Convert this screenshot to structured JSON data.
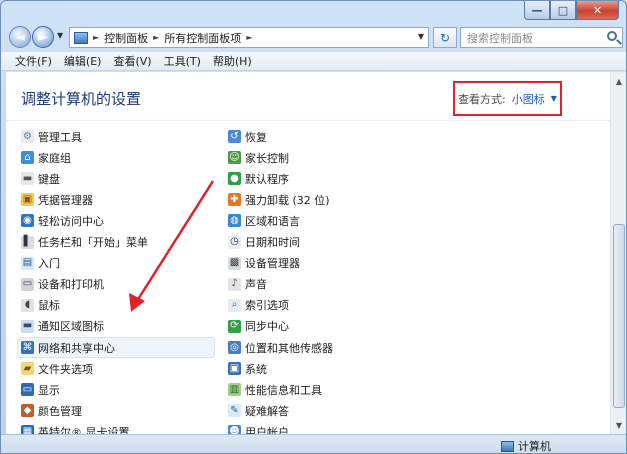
{
  "window": {
    "caption_buttons": {
      "minimize": "—",
      "maximize": "□",
      "close": "✕"
    }
  },
  "navigation": {
    "back": "◄",
    "forward": "►",
    "breadcrumbs": [
      "控制面板",
      "所有控制面板项"
    ],
    "refresh": "↻",
    "search_placeholder": "搜索控制面板"
  },
  "menu": [
    "文件(F)",
    "编辑(E)",
    "查看(V)",
    "工具(T)",
    "帮助(H)"
  ],
  "header": {
    "title": "调整计算机的设置",
    "view_by_label": "查看方式:",
    "view_by_value": "小图标"
  },
  "items_left": [
    {
      "label": "管理工具",
      "icon": "tools-icon"
    },
    {
      "label": "家庭组",
      "icon": "homegroup-icon"
    },
    {
      "label": "键盘",
      "icon": "keyboard-icon"
    },
    {
      "label": "凭据管理器",
      "icon": "credential-icon"
    },
    {
      "label": "轻松访问中心",
      "icon": "ease-of-access-icon"
    },
    {
      "label": "任务栏和「开始」菜单",
      "icon": "taskbar-icon"
    },
    {
      "label": "入门",
      "icon": "getting-started-icon"
    },
    {
      "label": "设备和打印机",
      "icon": "printer-icon"
    },
    {
      "label": "鼠标",
      "icon": "mouse-icon"
    },
    {
      "label": "通知区域图标",
      "icon": "notification-icon"
    },
    {
      "label": "网络和共享中心",
      "icon": "network-icon"
    },
    {
      "label": "文件夹选项",
      "icon": "folder-options-icon"
    },
    {
      "label": "显示",
      "icon": "display-icon"
    },
    {
      "label": "颜色管理",
      "icon": "color-management-icon"
    },
    {
      "label": "英特尔® 显卡设置",
      "icon": "intel-graphics-icon"
    }
  ],
  "items_right": [
    {
      "label": "恢复",
      "icon": "recovery-icon"
    },
    {
      "label": "家长控制",
      "icon": "parental-controls-icon"
    },
    {
      "label": "默认程序",
      "icon": "default-programs-icon"
    },
    {
      "label": "强力卸载 (32 位)",
      "icon": "uninstall-icon"
    },
    {
      "label": "区域和语言",
      "icon": "region-language-icon"
    },
    {
      "label": "日期和时间",
      "icon": "date-time-icon"
    },
    {
      "label": "设备管理器",
      "icon": "device-manager-icon"
    },
    {
      "label": "声音",
      "icon": "sound-icon"
    },
    {
      "label": "索引选项",
      "icon": "indexing-icon"
    },
    {
      "label": "同步中心",
      "icon": "sync-center-icon"
    },
    {
      "label": "位置和其他传感器",
      "icon": "location-sensors-icon"
    },
    {
      "label": "系统",
      "icon": "system-icon"
    },
    {
      "label": "性能信息和工具",
      "icon": "performance-icon"
    },
    {
      "label": "疑难解答",
      "icon": "troubleshooting-icon"
    },
    {
      "label": "用户帐户",
      "icon": "user-accounts-icon"
    }
  ],
  "status": {
    "computer": "计算机"
  },
  "colors": {
    "annotation": "#e0222a",
    "link": "#1f5db0",
    "title": "#1e3b7a"
  }
}
